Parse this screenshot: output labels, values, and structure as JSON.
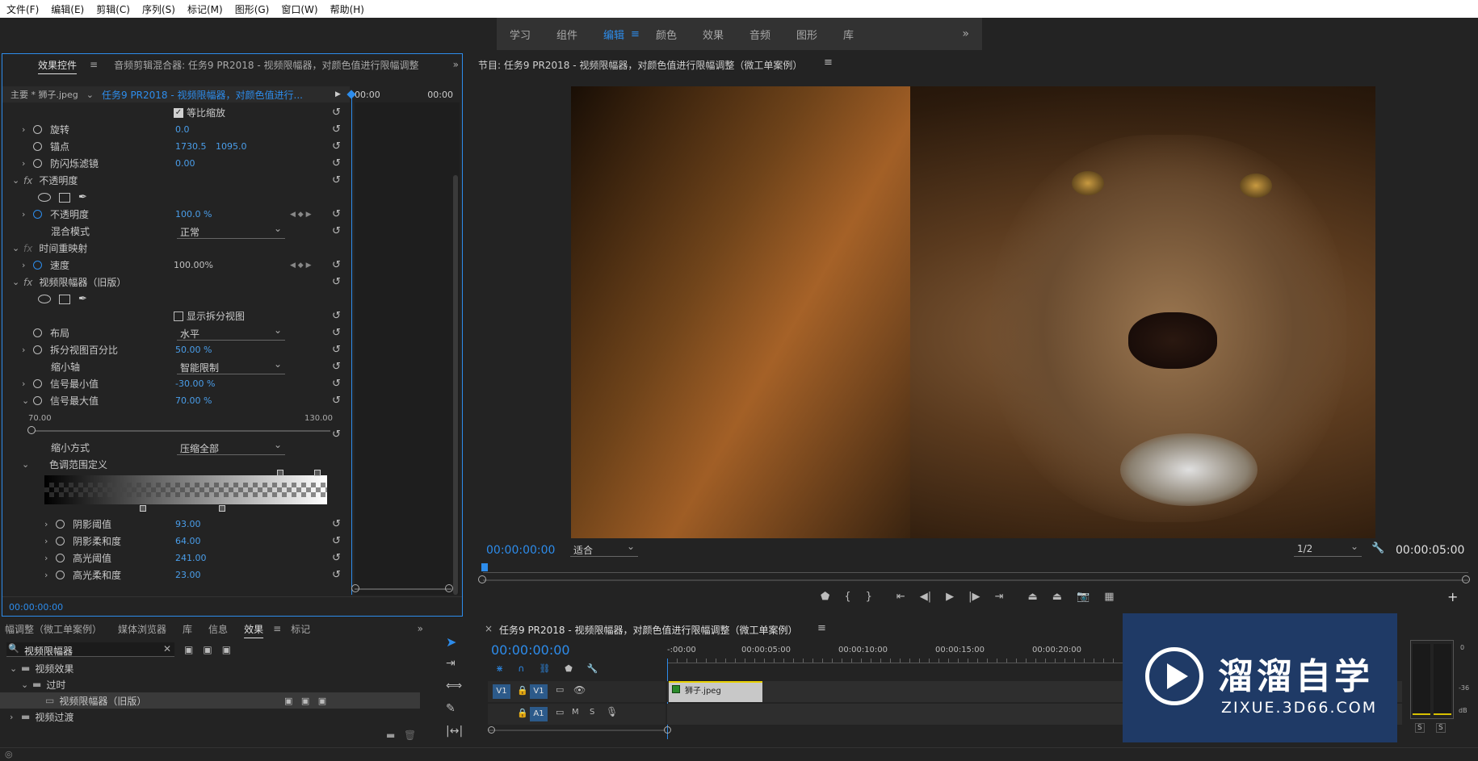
{
  "menu": [
    "文件(F)",
    "编辑(E)",
    "剪辑(C)",
    "序列(S)",
    "标记(M)",
    "图形(G)",
    "窗口(W)",
    "帮助(H)"
  ],
  "workspaces": [
    "学习",
    "组件",
    "编辑",
    "颜色",
    "效果",
    "音频",
    "图形",
    "库"
  ],
  "effect_controls": {
    "tab_title": "效果控件",
    "tab_mixer": "音频剪辑混合器: 任务9 PR2018 - 视频限幅器，对颜色值进行限幅调整",
    "master": "主要 * 狮子.jpeg",
    "sequence": "任务9 PR2018 - 视频限幅器，对颜色值进行...",
    "time_start": "00:00",
    "time_end": "00:00",
    "uniform_scale": "等比缩放",
    "rotation_label": "旋转",
    "rotation": "0.0",
    "anchor_label": "锚点",
    "anchor_x": "1730.5",
    "anchor_y": "1095.0",
    "flicker_label": "防闪烁滤镜",
    "flicker": "0.00",
    "opacity_group": "不透明度",
    "opacity_label": "不透明度",
    "opacity": "100.0 %",
    "blend_label": "混合模式",
    "blend": "正常",
    "timeremap_group": "时间重映射",
    "speed_label": "速度",
    "speed": "100.00%",
    "limiter_group": "视频限幅器（旧版）",
    "split_view": "显示拆分视图",
    "layout_label": "布局",
    "layout": "水平",
    "split_pct_label": "拆分视图百分比",
    "split_pct": "50.00 %",
    "reduce_axis_label": "缩小轴",
    "reduce_axis": "智能限制",
    "signal_min_label": "信号最小值",
    "signal_min": "-30.00 %",
    "signal_max_label": "信号最大值",
    "signal_max": "70.00 %",
    "slider_min": "70.00",
    "slider_max": "130.00",
    "reduce_method_label": "缩小方式",
    "reduce_method": "压缩全部",
    "tonal_label": "色调范围定义",
    "shadow_thresh_label": "阴影阈值",
    "shadow_thresh": "93.00",
    "shadow_soft_label": "阴影柔和度",
    "shadow_soft": "64.00",
    "highlight_thresh_label": "高光阈值",
    "highlight_thresh": "241.00",
    "highlight_soft_label": "高光柔和度",
    "highlight_soft": "23.00",
    "footer_time": "00:00:00:00"
  },
  "program": {
    "title": "节目: 任务9 PR2018 - 视频限幅器，对颜色值进行限幅调整（微工单案例）",
    "timecode": "00:00:00:00",
    "fit": "适合",
    "quality": "1/2",
    "duration": "00:00:05:00"
  },
  "effects_panel": {
    "tabs": [
      "幅调整（微工单案例）",
      "媒体浏览器",
      "库",
      "信息",
      "效果",
      "标记"
    ],
    "search": "视频限幅器",
    "tree": [
      "视频效果",
      "过时",
      "视频限幅器（旧版）",
      "视频过渡"
    ]
  },
  "timeline": {
    "title": "任务9 PR2018 - 视频限幅器，对颜色值进行限幅调整（微工单案例）",
    "timecode": "00:00:00:00",
    "ruler": [
      "-:00:00",
      "00:00:05:00",
      "00:00:10:00",
      "00:00:15:00",
      "00:00:20:00"
    ],
    "v1": "V1",
    "a1": "A1",
    "clip": "狮子.jpeg",
    "m": "M",
    "s": "S"
  },
  "meter": {
    "labels": [
      "0",
      "-36",
      "dB"
    ],
    "s1": "S",
    "s2": "S"
  },
  "watermark": {
    "brand": "溜溜自学",
    "url": "ZIXUE.3D66.COM"
  }
}
